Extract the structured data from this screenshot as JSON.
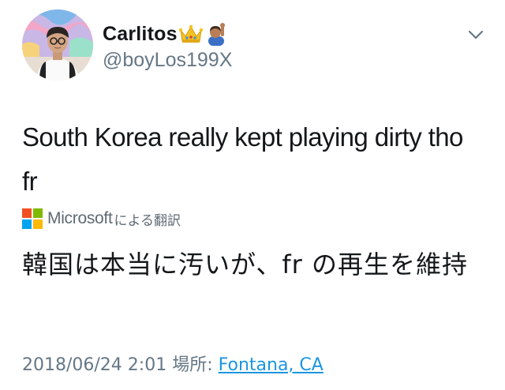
{
  "user": {
    "display_name": "Carlitos",
    "display_emojis": [
      "crown-emoji",
      "person-raising-hand-emoji"
    ],
    "handle": "@boyLos199X",
    "avatar": "profile-photo"
  },
  "menu": {
    "icon": "chevron-down-icon"
  },
  "tweet": {
    "text": "South Korea really kept playing dirty tho fr"
  },
  "translation": {
    "provider_logo": "microsoft-logo",
    "provider_logo_colors": [
      "#f25022",
      "#7fba00",
      "#00a4ef",
      "#ffb900"
    ],
    "provider_name": "Microsoft",
    "provider_suffix": "による翻訳",
    "text": "韓国は本当に汚いが、fr の再生を維持"
  },
  "meta": {
    "timestamp": "2018/06/24 2:01",
    "location_label": "場所:",
    "location_value": "Fontana, CA"
  },
  "colors": {
    "text": "#14171a",
    "secondary": "#657786",
    "link": "#1b95e0"
  }
}
